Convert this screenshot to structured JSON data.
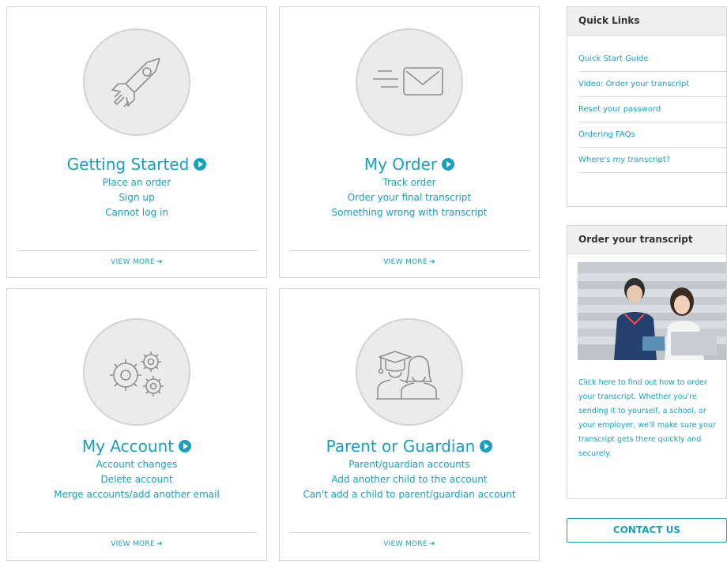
{
  "cards": [
    {
      "title": "Getting Started",
      "links": [
        "Place an order",
        "Sign up",
        "Cannot log in"
      ],
      "view_more": "VIEW MORE",
      "icon": "rocket-icon"
    },
    {
      "title": "My Order",
      "links": [
        "Track order",
        "Order your final transcript",
        "Something wrong with transcript"
      ],
      "view_more": "VIEW MORE",
      "icon": "envelope-icon"
    },
    {
      "title": "My Account",
      "links": [
        "Account changes",
        "Delete account",
        "Merge accounts/add another email"
      ],
      "view_more": "VIEW MORE",
      "icon": "gears-icon"
    },
    {
      "title": "Parent or Guardian",
      "links": [
        "Parent/guardian accounts",
        "Add another child to the account",
        "Can't add a child to parent/guardian account"
      ],
      "view_more": "VIEW MORE",
      "icon": "parent-graduate-icon"
    }
  ],
  "quick_links": {
    "title": "Quick Links",
    "items": [
      "Quick Start Guide",
      "Video: Order your transcript",
      "Reset your password",
      "Ordering FAQs",
      "Where's my transcript?"
    ]
  },
  "order_box": {
    "title": "Order your transcript",
    "text": "Click here to find out how to order your transcript. Whether you're sending it to yourself, a school, or your employer, we'll make sure your transcript gets there quickly and securely."
  },
  "contact_label": "CONTACT US",
  "colors": {
    "accent": "#1aa0bf",
    "icon_gray": "#9a9a9a",
    "border": "#d6d6d6"
  }
}
